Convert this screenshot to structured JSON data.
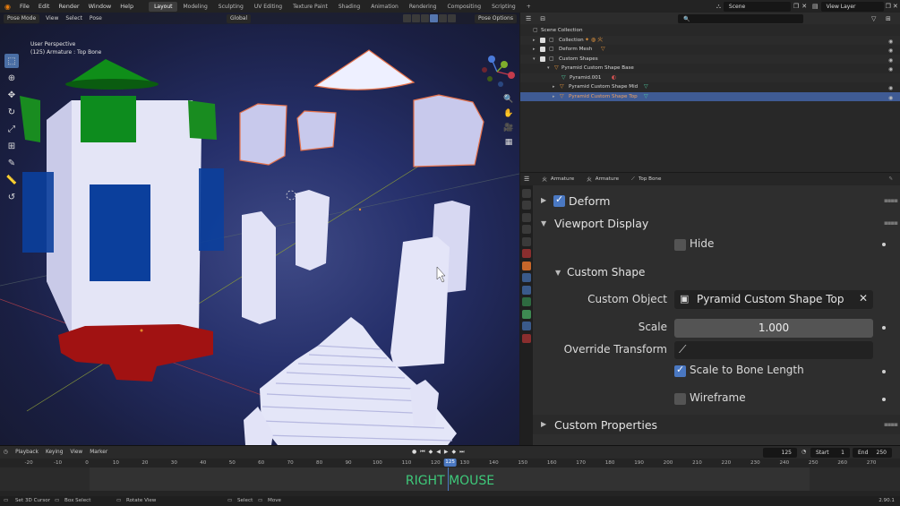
{
  "topbar": {
    "menus": [
      "File",
      "Edit",
      "Render",
      "Window",
      "Help"
    ],
    "workspaces": [
      "Layout",
      "Modeling",
      "Sculpting",
      "UV Editing",
      "Texture Paint",
      "Shading",
      "Animation",
      "Rendering",
      "Compositing",
      "Scripting"
    ],
    "active_workspace": "Layout",
    "scene": "Scene",
    "view_layer": "View Layer"
  },
  "viewport": {
    "mode": "Pose Mode",
    "menus": [
      "View",
      "Select",
      "Pose"
    ],
    "orientation": "Global",
    "pose_options": "Pose Options",
    "info_line1": "User Perspective",
    "info_line2": "(125) Armature : Top Bone",
    "gizmo_x": "X",
    "gizmo_y": "Y",
    "gizmo_z": "Z"
  },
  "outliner": {
    "rows": [
      {
        "label": "Scene Collection"
      },
      {
        "label": "Collection"
      },
      {
        "label": "Deform Mesh"
      },
      {
        "label": "Custom Shapes"
      },
      {
        "label": "Pyramid Custom Shape Base"
      },
      {
        "label": "Pyramid.001"
      },
      {
        "label": "Pyramid Custom Shape Mid"
      },
      {
        "label": "Pyramid Custom Shape Top"
      }
    ]
  },
  "properties": {
    "breadcrumb": [
      "Armature",
      "Armature",
      "Top Bone"
    ],
    "deform_label": "Deform",
    "deform_checked": true,
    "viewport_display_label": "Viewport Display",
    "hide_label": "Hide",
    "hide_checked": false,
    "custom_shape_label": "Custom Shape",
    "custom_object_label": "Custom Object",
    "custom_object_value": "Pyramid Custom Shape Top",
    "scale_label": "Scale",
    "scale_value": "1.000",
    "override_transform_label": "Override Transform",
    "scale_to_bone_label": "Scale to Bone Length",
    "scale_to_bone_checked": true,
    "wireframe_label": "Wireframe",
    "wireframe_checked": false,
    "custom_properties_label": "Custom Properties"
  },
  "timeline": {
    "menus": [
      "Playback",
      "Keying",
      "View",
      "Marker"
    ],
    "current_frame": "125",
    "start_label": "Start",
    "start_value": "1",
    "end_label": "End",
    "end_value": "250",
    "ticks": [
      "-20",
      "-10",
      "0",
      "10",
      "20",
      "30",
      "40",
      "50",
      "60",
      "70",
      "80",
      "90",
      "100",
      "110",
      "120",
      "130",
      "140",
      "150",
      "160",
      "170",
      "180",
      "190",
      "200",
      "210",
      "220",
      "230",
      "240",
      "250",
      "260",
      "270"
    ],
    "overlay_text": "RIGHT MOUSE"
  },
  "statusbar": {
    "items": [
      "Set 3D Cursor",
      "Box Select",
      "Rotate View",
      "Select",
      "Move"
    ],
    "version": "2.90.1"
  },
  "colors": {
    "accent": "#4a78c2",
    "selected_row": "#3f5b94",
    "overlay_green": "#3ec97a"
  }
}
